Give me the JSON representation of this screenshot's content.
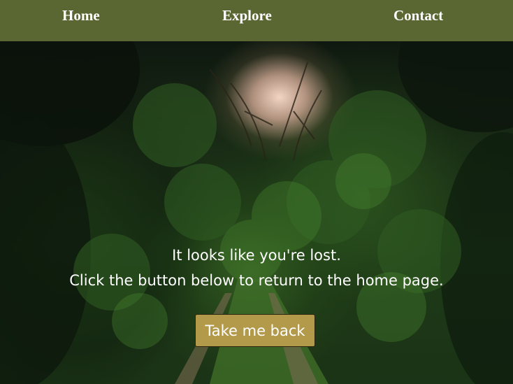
{
  "nav": {
    "items": [
      {
        "label": "Home"
      },
      {
        "label": "Explore"
      },
      {
        "label": "Contact"
      }
    ],
    "background": "#5a6732"
  },
  "hero": {
    "image": "forest-path-photo",
    "line1": "It looks like you're lost.",
    "line2": "Click the button below to return to the home page."
  },
  "button": {
    "label": "Take me back",
    "color": "#b3994a"
  }
}
